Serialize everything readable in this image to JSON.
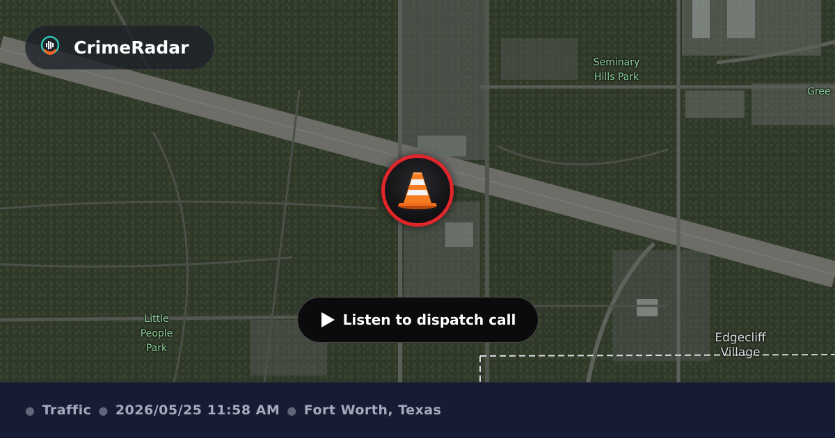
{
  "brand": {
    "name": "CrimeRadar",
    "logo_icon": "radar-pin-icon"
  },
  "marker": {
    "icon": "traffic-cone-icon",
    "ring_color": "#e0262b"
  },
  "cta": {
    "label": "Listen to dispatch call",
    "icon": "play-icon"
  },
  "map_labels": {
    "seminary": "Seminary Hills Park",
    "little_people": "Little People Park",
    "edgecliff": "Edgecliff Village",
    "green_partial": "Gree"
  },
  "footer": {
    "category": "Traffic",
    "datetime": "2026/05/25 11:58 AM",
    "location": "Fort Worth, Texas"
  }
}
